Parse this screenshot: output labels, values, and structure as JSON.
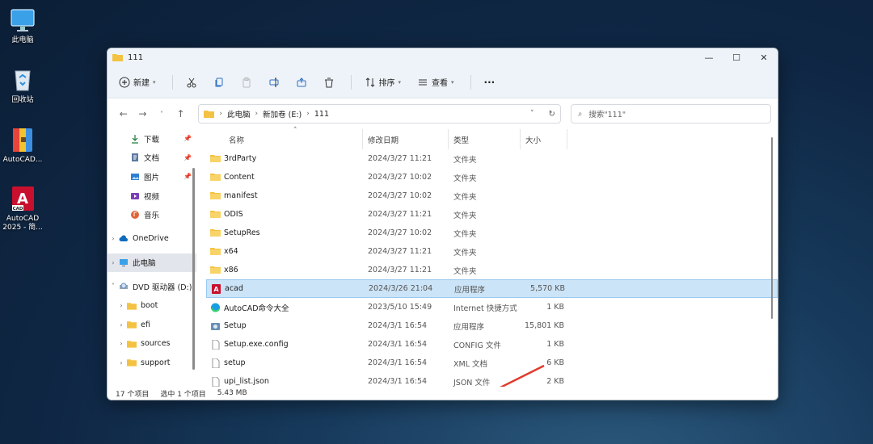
{
  "desktop": {
    "icons": [
      {
        "label": "此电脑",
        "icon": "monitor-icon"
      },
      {
        "label": "回收站",
        "icon": "recycle-bin-icon"
      },
      {
        "label": "AutoCAD...",
        "icon": "archive-icon"
      },
      {
        "label_line1": "AutoCAD",
        "label_line2": "2025 - 简...",
        "icon": "autocad-icon"
      }
    ]
  },
  "window": {
    "title": "111",
    "controls": {
      "minimize": "—",
      "maximize": "☐",
      "close": "✕"
    }
  },
  "toolbar": {
    "new_label": "新建",
    "sort_label": "排序",
    "view_label": "查看",
    "more_label": "···"
  },
  "address": {
    "segments": [
      "此电脑",
      "新加卷 (E:)",
      "111"
    ],
    "search_placeholder": "搜索\"111\""
  },
  "sidebar": {
    "quick_access": [
      {
        "label": "下载",
        "pinned": true,
        "icon": "download-icon"
      },
      {
        "label": "文档",
        "pinned": true,
        "icon": "document-icon"
      },
      {
        "label": "图片",
        "pinned": true,
        "icon": "picture-icon"
      },
      {
        "label": "视频",
        "pinned": false,
        "icon": "video-icon"
      },
      {
        "label": "音乐",
        "pinned": false,
        "icon": "music-icon"
      }
    ],
    "onedrive": "OneDrive",
    "this_pc": "此电脑",
    "dvd": "DVD 驱动器 (D:)",
    "dvd_children": [
      "boot",
      "efi",
      "sources",
      "support"
    ]
  },
  "columns": {
    "name": "名称",
    "date": "修改日期",
    "type": "类型",
    "size": "大小"
  },
  "files": [
    {
      "name": "3rdParty",
      "date": "2024/3/27 11:21",
      "type": "文件夹",
      "size": "",
      "icon": "folder-icon"
    },
    {
      "name": "Content",
      "date": "2024/3/27 10:02",
      "type": "文件夹",
      "size": "",
      "icon": "folder-icon"
    },
    {
      "name": "manifest",
      "date": "2024/3/27 10:02",
      "type": "文件夹",
      "size": "",
      "icon": "folder-icon"
    },
    {
      "name": "ODIS",
      "date": "2024/3/27 11:21",
      "type": "文件夹",
      "size": "",
      "icon": "folder-icon"
    },
    {
      "name": "SetupRes",
      "date": "2024/3/27 10:02",
      "type": "文件夹",
      "size": "",
      "icon": "folder-icon"
    },
    {
      "name": "x64",
      "date": "2024/3/27 11:21",
      "type": "文件夹",
      "size": "",
      "icon": "folder-icon"
    },
    {
      "name": "x86",
      "date": "2024/3/27 11:21",
      "type": "文件夹",
      "size": "",
      "icon": "folder-icon"
    },
    {
      "name": "acad",
      "date": "2024/3/26 21:04",
      "type": "应用程序",
      "size": "5,570 KB",
      "icon": "autocad-app-icon",
      "selected": true
    },
    {
      "name": "AutoCAD命令大全",
      "date": "2023/5/10 15:49",
      "type": "Internet 快捷方式",
      "size": "1 KB",
      "icon": "edge-icon"
    },
    {
      "name": "Setup",
      "date": "2024/3/1 16:54",
      "type": "应用程序",
      "size": "15,801 KB",
      "icon": "setup-icon"
    },
    {
      "name": "Setup.exe.config",
      "date": "2024/3/1 16:54",
      "type": "CONFIG 文件",
      "size": "1 KB",
      "icon": "file-icon"
    },
    {
      "name": "setup",
      "date": "2024/3/1 16:54",
      "type": "XML 文档",
      "size": "6 KB",
      "icon": "file-icon"
    },
    {
      "name": "upi_list.json",
      "date": "2024/3/1 16:54",
      "type": "JSON 文件",
      "size": "2 KB",
      "icon": "file-icon"
    }
  ],
  "status": {
    "count": "17 个项目",
    "selected": "选中 1 个项目",
    "size": "5.43 MB"
  },
  "colors": {
    "selection_bg": "#cce4f7",
    "folder": "#f4c243",
    "arrow": "#e03a2a"
  }
}
